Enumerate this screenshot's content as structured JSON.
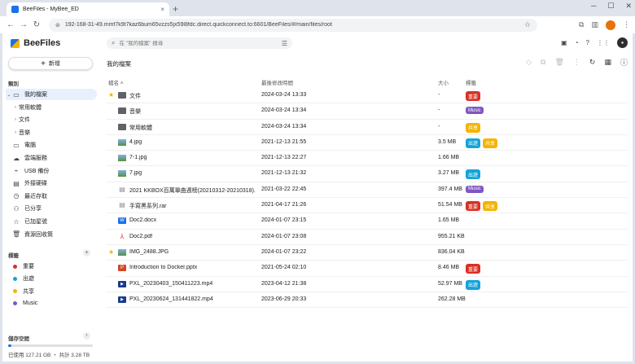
{
  "browser": {
    "tab_title": "BeeFiles - MyBee_ED",
    "tab_close": "×",
    "new_tab": "+",
    "url": "192-168-31-49.mmf7k9t7kaz6bum65vzzs5jx59l8fdc.direct.quickconnect.to:6601/BeeFiles/#/main/files/root"
  },
  "app": {
    "name": "BeeFiles",
    "new_button": "新增",
    "search_placeholder": "在 \"我的檔案\" 搜尋"
  },
  "sidebar": {
    "section_title": "類別",
    "items": [
      {
        "label": "我的檔案",
        "icon": "folder-icon",
        "active": true,
        "caret": "⌄"
      },
      {
        "label": "常用軟體",
        "icon": "",
        "sub": true,
        "caret": "›"
      },
      {
        "label": "文件",
        "icon": "",
        "sub": true,
        "caret": "›"
      },
      {
        "label": "音樂",
        "icon": "",
        "sub": true,
        "caret": "›"
      },
      {
        "label": "電腦",
        "icon": "computer-icon"
      },
      {
        "label": "雲端服務",
        "icon": "cloud-icon"
      },
      {
        "label": "USB 備份",
        "icon": "usb-icon"
      },
      {
        "label": "外接硬碟",
        "icon": "drive-icon"
      },
      {
        "label": "最近存取",
        "icon": "clock-icon"
      },
      {
        "label": "已分享",
        "icon": "share-icon"
      },
      {
        "label": "已加星號",
        "icon": "star-icon"
      },
      {
        "label": "資源回收筒",
        "icon": "trash-icon"
      }
    ],
    "tags_title": "標籤",
    "tags": [
      {
        "label": "重要",
        "color": "#d93025"
      },
      {
        "label": "出遊",
        "color": "#12a4d9"
      },
      {
        "label": "共享",
        "color": "#f4b400"
      },
      {
        "label": "Music",
        "color": "#7e57c2"
      }
    ],
    "storage_title": "儲存空間",
    "storage_text": "已使用 127.21 GB ・ 共計 3.28 TB",
    "storage_fraction": 0.038
  },
  "main": {
    "page_title": "我的檔案",
    "columns": {
      "name": "檔名 ˄",
      "date": "最後修改時間",
      "size": "大小",
      "tags": "標籤"
    }
  },
  "files": [
    {
      "name": "文件",
      "type": "folder",
      "date": "2024-03-24 13:33",
      "size": "-",
      "tags": [
        "重要"
      ],
      "starred": true
    },
    {
      "name": "音樂",
      "type": "folder",
      "date": "2024-03-24 13:34",
      "size": "-",
      "tags": [
        "Music"
      ],
      "starred": false
    },
    {
      "name": "常用軟體",
      "type": "folder",
      "date": "2024-03-24 13:34",
      "size": "-",
      "tags": [
        "共享"
      ],
      "starred": false
    },
    {
      "name": "4.jpg",
      "type": "image",
      "date": "2021-12-13 21:55",
      "size": "3.5 MB",
      "tags": [
        "出遊",
        "共享"
      ],
      "starred": false
    },
    {
      "name": "7-1.jpg",
      "type": "image",
      "date": "2021-12-13 22:27",
      "size": "1.66 MB",
      "tags": [],
      "starred": false
    },
    {
      "name": "7.jpg",
      "type": "image",
      "date": "2021-12-13 21:32",
      "size": "3.27 MB",
      "tags": [
        "出遊"
      ],
      "starred": false
    },
    {
      "name": "2021 KKBOX百萬單曲週榜(20210312-20210318)...",
      "type": "archive",
      "date": "2021-03-22 22:45",
      "size": "397.4 MB",
      "tags": [
        "Music"
      ],
      "starred": false
    },
    {
      "name": "手寫黑系列.rar",
      "type": "archive",
      "date": "2021-04-17 21:26",
      "size": "51.54 MB",
      "tags": [
        "重要",
        "共享"
      ],
      "starred": false
    },
    {
      "name": "Doc2.docx",
      "type": "doc",
      "date": "2024-01-07 23:15",
      "size": "1.65 MB",
      "tags": [],
      "starred": false
    },
    {
      "name": "Doc2.pdf",
      "type": "pdf",
      "date": "2024-01-07 23:08",
      "size": "955.21 KB",
      "tags": [],
      "starred": false
    },
    {
      "name": "IMG_2488.JPG",
      "type": "image",
      "date": "2024-01-07 23:22",
      "size": "836.04 KB",
      "tags": [],
      "starred": true
    },
    {
      "name": "Introduction to Docker.pptx",
      "type": "ppt",
      "date": "2021-05-24 02:10",
      "size": "8.46 MB",
      "tags": [
        "重要"
      ],
      "starred": false
    },
    {
      "name": "PXL_20230403_150411223.mp4",
      "type": "video",
      "date": "2023-04-12 21:38",
      "size": "52.97 MB",
      "tags": [
        "出遊"
      ],
      "starred": false
    },
    {
      "name": "PXL_20230624_131441822.mp4",
      "type": "video",
      "date": "2023-06-29 20:33",
      "size": "262.28 MB",
      "tags": [],
      "starred": false
    }
  ],
  "tag_colors": {
    "重要": "#d93025",
    "出遊": "#12a4d9",
    "共享": "#f4b400",
    "Music": "#7e57c2"
  }
}
